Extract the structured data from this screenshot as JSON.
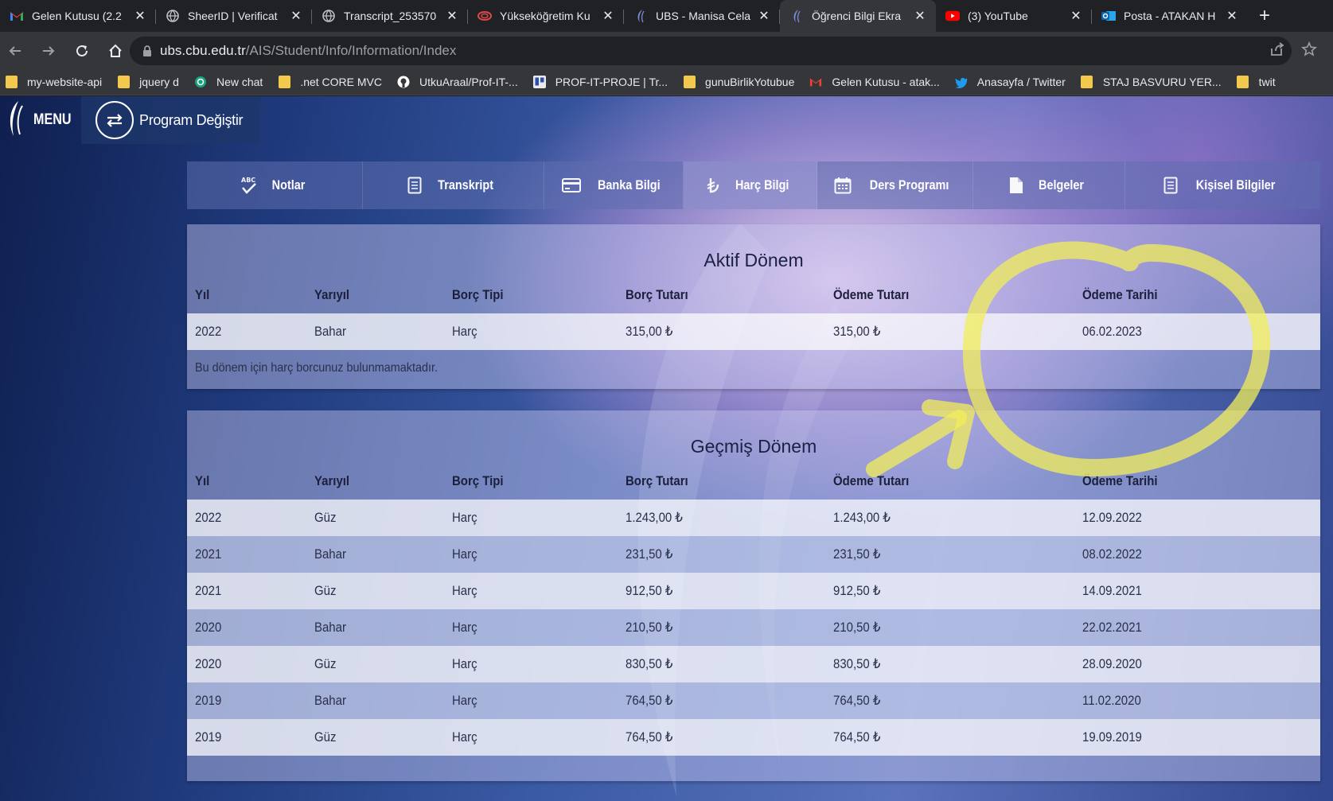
{
  "browser": {
    "tabs": [
      {
        "title": "Gelen Kutusu (2.2",
        "icon": "gmail-icon"
      },
      {
        "title": "SheerID | Verificat",
        "icon": "globe-icon"
      },
      {
        "title": "Transcript_253570",
        "icon": "globe-icon"
      },
      {
        "title": "Yükseköğretim Ku",
        "icon": "yok-icon"
      },
      {
        "title": "UBS - Manisa Cela",
        "icon": "ubs-icon"
      },
      {
        "title": "Öğrenci Bilgi Ekra",
        "icon": "ubs-icon",
        "active": true
      },
      {
        "title": "(3) YouTube",
        "icon": "youtube-icon"
      },
      {
        "title": "Posta - ATAKAN H",
        "icon": "outlook-icon"
      }
    ],
    "url_host": "ubs.cbu.edu.tr",
    "url_path": "/AIS/Student/Info/Information/Index",
    "bookmarks": [
      {
        "label": "my-website-api",
        "icon": "folder-icon"
      },
      {
        "label": "jquery d",
        "icon": "folder-icon"
      },
      {
        "label": "New chat",
        "icon": "openai-icon"
      },
      {
        "label": ".net CORE MVC",
        "icon": "folder-icon"
      },
      {
        "label": "UtkuAraal/Prof-IT-...",
        "icon": "github-icon"
      },
      {
        "label": "PROF-IT-PROJE | Tr...",
        "icon": "trello-icon"
      },
      {
        "label": "gunuBirlikYotubue",
        "icon": "folder-icon"
      },
      {
        "label": "Gelen Kutusu - atak...",
        "icon": "gmail-icon"
      },
      {
        "label": "Anasayfa / Twitter",
        "icon": "twitter-icon"
      },
      {
        "label": "STAJ BASVURU YER...",
        "icon": "folder-icon"
      },
      {
        "label": "twit",
        "icon": "folder-icon"
      }
    ]
  },
  "header": {
    "menu_label": "MENU",
    "program_label": "Program Değiştir"
  },
  "nav": {
    "tabs": [
      {
        "label": "Notlar",
        "icon": "abc-check-icon"
      },
      {
        "label": "Transkript",
        "icon": "document-list-icon"
      },
      {
        "label": "Banka Bilgi",
        "icon": "credit-card-icon"
      },
      {
        "label": "Harç Bilgi",
        "icon": "lira-icon",
        "active": true
      },
      {
        "label": "Ders Programı",
        "icon": "calendar-icon"
      },
      {
        "label": "Belgeler",
        "icon": "file-icon"
      },
      {
        "label": "Kişisel Bilgiler",
        "icon": "document-list-icon"
      }
    ]
  },
  "columns": [
    "Yıl",
    "Yarıyıl",
    "Borç Tipi",
    "Borç Tutarı",
    "Ödeme Tutarı",
    "Ödeme Tarihi"
  ],
  "active_term": {
    "title": "Aktif Dönem",
    "rows": [
      [
        "2022",
        "Bahar",
        "Harç",
        "315,00 ₺",
        "315,00 ₺",
        "06.02.2023"
      ]
    ],
    "note": "Bu dönem için harç borcunuz bulunmamaktadır."
  },
  "past_terms": {
    "title": "Geçmiş Dönem",
    "rows": [
      [
        "2022",
        "Güz",
        "Harç",
        "1.243,00 ₺",
        "1.243,00 ₺",
        "12.09.2022"
      ],
      [
        "2021",
        "Bahar",
        "Harç",
        "231,50 ₺",
        "231,50 ₺",
        "08.02.2022"
      ],
      [
        "2021",
        "Güz",
        "Harç",
        "912,50 ₺",
        "912,50 ₺",
        "14.09.2021"
      ],
      [
        "2020",
        "Bahar",
        "Harç",
        "210,50 ₺",
        "210,50 ₺",
        "22.02.2021"
      ],
      [
        "2020",
        "Güz",
        "Harç",
        "830,50 ₺",
        "830,50 ₺",
        "28.09.2020"
      ],
      [
        "2019",
        "Bahar",
        "Harç",
        "764,50 ₺",
        "764,50 ₺",
        "11.02.2020"
      ],
      [
        "2019",
        "Güz",
        "Harç",
        "764,50 ₺",
        "764,50 ₺",
        "19.09.2019"
      ]
    ]
  },
  "annotation_color": "#f2ee5a"
}
